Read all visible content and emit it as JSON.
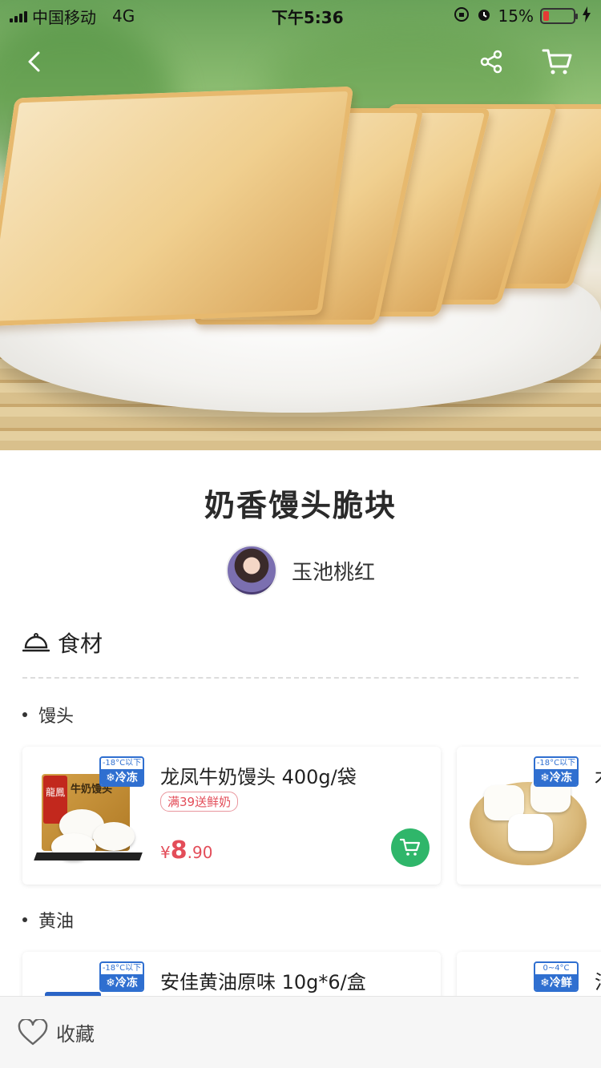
{
  "status_bar": {
    "carrier": "中国移动",
    "network": "4G",
    "time": "下午5:36",
    "battery": "15%",
    "battery_level": 0.15
  },
  "nav": {
    "back_icon": "chevron-left-icon",
    "share_icon": "share-icon",
    "cart_icon": "cart-icon"
  },
  "recipe": {
    "title": "奶香馒头脆块",
    "author": "玉池桃红"
  },
  "ingredients_section": {
    "title": "食材",
    "icon": "cloche-icon",
    "items": [
      {
        "label": "馒头"
      },
      {
        "label": "黄油"
      }
    ]
  },
  "products": [
    {
      "name": "龙凤牛奶馒头 400g/袋",
      "badge_top": "-18°C以下",
      "badge_bottom": "❄冷冻",
      "promo": "满39送鲜奶",
      "price_currency": "¥",
      "price_int": "8",
      "price_dec": ".90",
      "package_text": "牛奶馒头",
      "brand_text": "龍鳳"
    },
    {
      "name": "",
      "badge_top": "-18°C以下",
      "badge_bottom": "❄冷冻",
      "partial_text": "木"
    },
    {
      "name": "安佳黄油原味 10g*6/盒",
      "badge_top": "-18°C以下",
      "badge_bottom": "❄冷冻"
    },
    {
      "name": "",
      "badge_top": "0~4°C",
      "badge_bottom": "❄冷鲜",
      "partial_text": "汁"
    }
  ],
  "bottom_bar": {
    "favorite_label": "收藏",
    "favorite_icon": "heart-outline-icon"
  },
  "colors": {
    "accent_green": "#2fb66a",
    "price_red": "#e34d59",
    "badge_blue": "#2f6fd0"
  }
}
